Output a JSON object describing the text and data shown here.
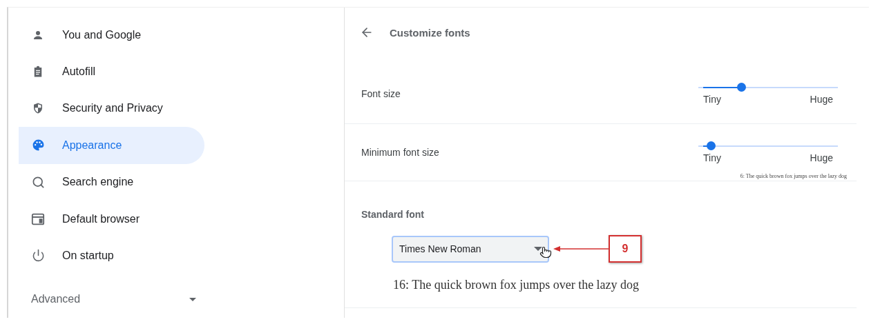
{
  "sidebar": {
    "items": [
      {
        "label": "You and Google",
        "selected": false
      },
      {
        "label": "Autofill",
        "selected": false
      },
      {
        "label": "Security and Privacy",
        "selected": false
      },
      {
        "label": "Appearance",
        "selected": true
      },
      {
        "label": "Search engine",
        "selected": false
      },
      {
        "label": "Default browser",
        "selected": false
      },
      {
        "label": "On startup",
        "selected": false
      }
    ],
    "advanced": {
      "label": "Advanced",
      "expanded": false
    }
  },
  "page": {
    "title": "Customize fonts",
    "sliders": [
      {
        "label": "Font size",
        "level": 0.29,
        "min_label": "Tiny",
        "max_label": "Huge"
      },
      {
        "label": "Minimum font size",
        "level": 0.06,
        "min_label": "Tiny",
        "max_label": "Huge",
        "preview": "6: The quick brown fox jumps over the lazy dog"
      }
    ],
    "standard_font": {
      "label": "Standard font",
      "value": "Times New Roman",
      "preview": "16: The quick brown fox jumps over the lazy dog"
    }
  },
  "annotation": {
    "label": "9"
  }
}
